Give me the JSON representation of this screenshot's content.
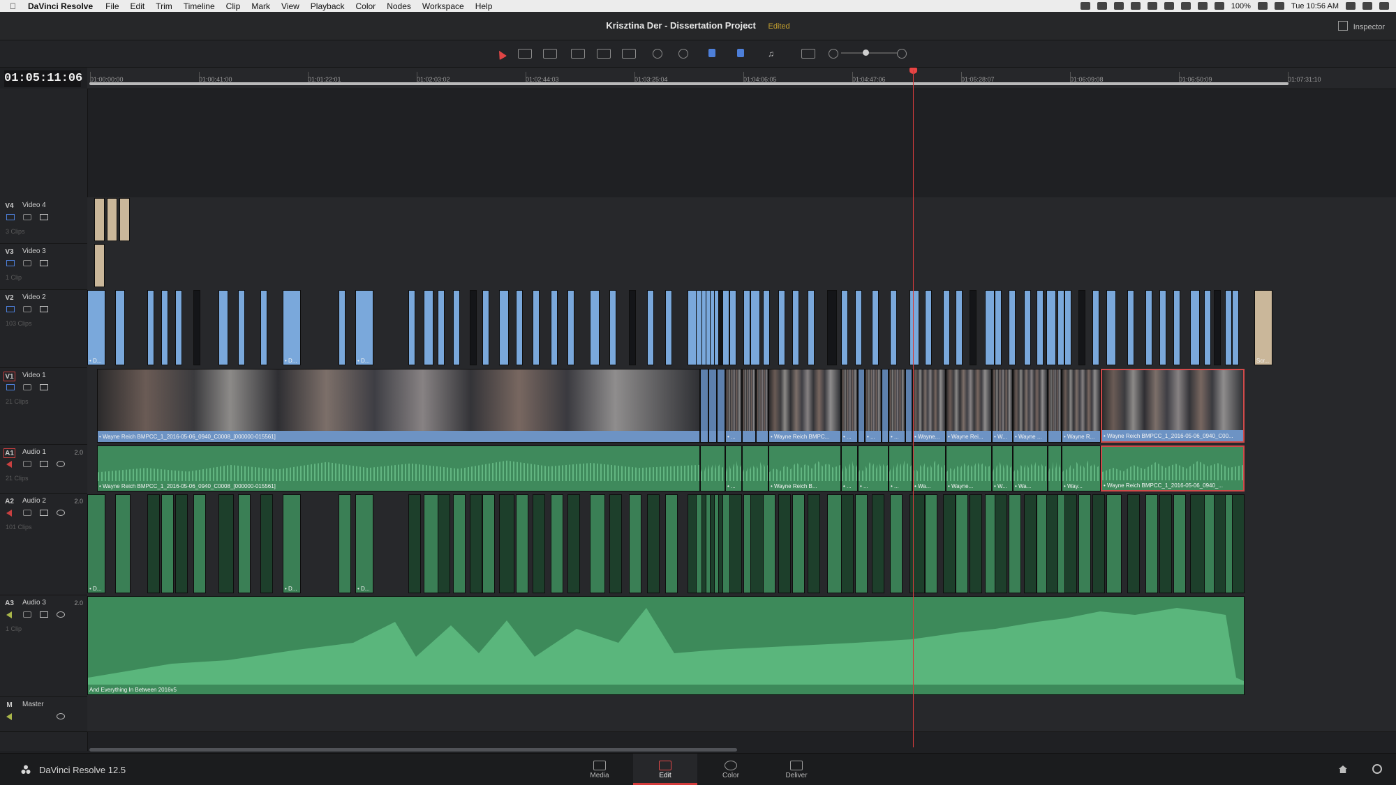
{
  "menubar": {
    "app_name": "DaVinci Resolve",
    "items": [
      "File",
      "Edit",
      "Trim",
      "Timeline",
      "Clip",
      "Mark",
      "View",
      "Playback",
      "Color",
      "Nodes",
      "Workspace",
      "Help"
    ],
    "battery": "100%",
    "clock": "Tue 10:56 AM"
  },
  "window": {
    "project_title": "Krisztina Der - Dissertation Project",
    "status": "Edited",
    "inspector_label": "Inspector"
  },
  "timecode": "01:05:11:06",
  "ruler": {
    "ticks": [
      "01:00:00:00",
      "01:00:41:00",
      "01:01:22:01",
      "01:02:03:02",
      "01:02:44:03",
      "01:03:25:04",
      "01:04:06:05",
      "01:04:47:06",
      "01:05:28:07",
      "01:06:09:08",
      "01:06:50:09",
      "01:07:31:10"
    ]
  },
  "tracks": {
    "v4": {
      "id": "V4",
      "name": "Video 4",
      "clips": "3 Clips"
    },
    "v3": {
      "id": "V3",
      "name": "Video 3",
      "clips": "1 Clip"
    },
    "v2": {
      "id": "V2",
      "name": "Video 2",
      "clips": "103 Clips"
    },
    "v1": {
      "id": "V1",
      "name": "Video 1",
      "clips": "21 Clips"
    },
    "a1": {
      "id": "A1",
      "name": "Audio 1",
      "channels": "2.0",
      "clips": "21 Clips"
    },
    "a2": {
      "id": "A2",
      "name": "Audio 2",
      "channels": "2.0",
      "clips": "101 Clips"
    },
    "a3": {
      "id": "A3",
      "name": "Audio 3",
      "channels": "2.0",
      "clips": "1 Clip"
    },
    "master": {
      "id": "M",
      "name": "Master"
    }
  },
  "clip_labels": {
    "v2_short": "• D...",
    "v2_scr": "Scr...",
    "v1_main": "• Wayne Reich BMPCC_1_2016-05-06_0940_C0008_[000000-015561]",
    "v1_mid": "• Wayne Reich BMPC...",
    "v1_s1": "• ...",
    "v1_s2": "• Wayne...",
    "v1_s3": "• Wayne Rei...",
    "v1_s4": "• W...",
    "v1_s5": "• Wayne ...",
    "v1_s6": "• Wayne R...",
    "v1_end": "• Wayne Reich BMPCC_1_2016-05-06_0940_C00...",
    "a1_main": "• Wayne Reich BMPCC_1_2016-05-06_0940_C0008_[000000-015561]",
    "a1_mid": "• Wayne Reich B...",
    "a1_s1": "• Wa...",
    "a1_s2": "• Wayne...",
    "a1_s3": "• W...",
    "a1_s4": "• Way...",
    "a1_end": "• Wayne Reich BMPCC_1_2016-05-06_0940_...",
    "a2_short": "• D...",
    "a3_main": "And Everything In Between 2016v5"
  },
  "bottombar": {
    "brand": "DaVinci Resolve 12.5",
    "pages": [
      {
        "label": "Media",
        "icon": "media-icon"
      },
      {
        "label": "Edit",
        "icon": "edit-icon"
      },
      {
        "label": "Color",
        "icon": "color-icon"
      },
      {
        "label": "Deliver",
        "icon": "deliver-icon"
      }
    ],
    "active_page": "Edit"
  },
  "colors": {
    "accent_red": "#d33b3b",
    "video_clip_blue": "#7aa8db",
    "audio_clip_green": "#3f8a5c",
    "edited_yellow": "#c6a12f"
  }
}
